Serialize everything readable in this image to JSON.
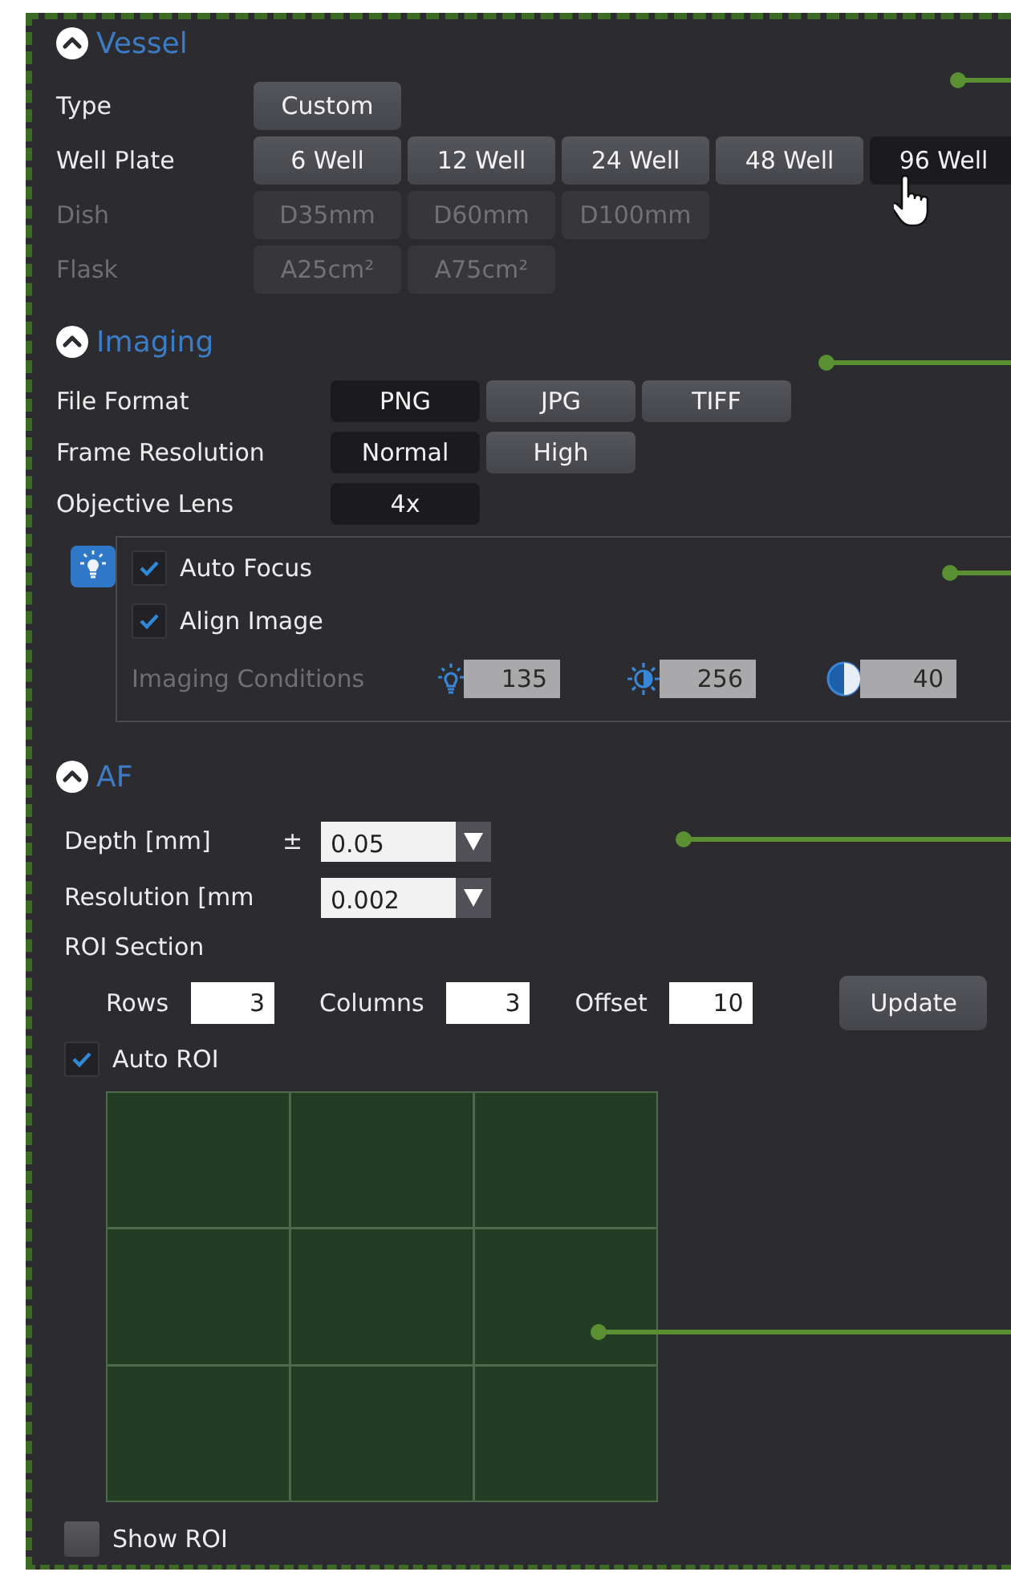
{
  "vessel": {
    "title": "Vessel",
    "expanded": true,
    "rows": [
      {
        "label": "Type",
        "disabled": false,
        "options": [
          {
            "label": "Custom",
            "selected": false
          }
        ]
      },
      {
        "label": "Well Plate",
        "disabled": false,
        "options": [
          {
            "label": "6 Well",
            "selected": false
          },
          {
            "label": "12 Well",
            "selected": false
          },
          {
            "label": "24 Well",
            "selected": false
          },
          {
            "label": "48 Well",
            "selected": false
          },
          {
            "label": "96 Well",
            "selected": true
          }
        ]
      },
      {
        "label": "Dish",
        "disabled": true,
        "options": [
          {
            "label": "D35mm",
            "selected": false
          },
          {
            "label": "D60mm",
            "selected": false
          },
          {
            "label": "D100mm",
            "selected": false
          }
        ]
      },
      {
        "label": "Flask",
        "disabled": true,
        "options": [
          {
            "label": "A25cm²",
            "selected": false
          },
          {
            "label": "A75cm²",
            "selected": false
          }
        ]
      }
    ]
  },
  "imaging": {
    "title": "Imaging",
    "expanded": true,
    "rows": [
      {
        "label": "File Format",
        "disabled": false,
        "options": [
          {
            "label": "PNG",
            "selected": true
          },
          {
            "label": "JPG",
            "selected": false
          },
          {
            "label": "TIFF",
            "selected": false
          }
        ]
      },
      {
        "label": "Frame Resolution",
        "disabled": false,
        "options": [
          {
            "label": "Normal",
            "selected": true
          },
          {
            "label": "High",
            "selected": false
          }
        ]
      },
      {
        "label": "Objective Lens",
        "disabled": false,
        "options": [
          {
            "label": "4x",
            "selected": true
          }
        ]
      }
    ],
    "options_box": {
      "checks": [
        {
          "label": "Auto Focus",
          "checked": true
        },
        {
          "label": "Align Image",
          "checked": true
        }
      ],
      "conditions": {
        "label": "Imaging Conditions",
        "disabled": true,
        "fields": [
          {
            "kind": "light",
            "value": "135"
          },
          {
            "kind": "brightness",
            "value": "256"
          },
          {
            "kind": "contrast",
            "value": "40"
          }
        ]
      }
    }
  },
  "af": {
    "title": "AF",
    "expanded": true,
    "depth": {
      "label": "Depth [mm]",
      "prefix": "±",
      "value": "0.05"
    },
    "resolution": {
      "label": "Resolution [mm",
      "value": "0.002"
    },
    "roi_section": {
      "label": "ROI Section",
      "fields": [
        {
          "label": "Rows",
          "value": "3"
        },
        {
          "label": "Columns",
          "value": "3"
        },
        {
          "label": "Offset",
          "value": "10"
        }
      ],
      "button": "Update"
    },
    "auto_roi": {
      "label": "Auto ROI",
      "checked": true
    },
    "show_roi": {
      "label": "Show ROI",
      "checked": false
    }
  }
}
